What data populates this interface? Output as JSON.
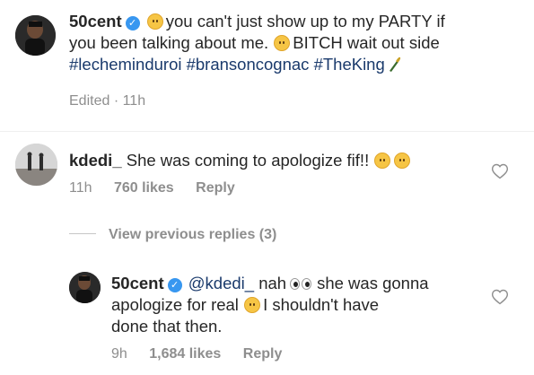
{
  "post": {
    "username": "50cent",
    "caption_part1": "you can't just show up to my PARTY if",
    "caption_part2": "you been talking about me.",
    "caption_part3": "BITCH wait out side",
    "hashtags": [
      "#lecheminduroi",
      "#bransoncognac",
      "#TheKing"
    ],
    "edited": "Edited",
    "time": "11h"
  },
  "comment": {
    "username": "kdedi_",
    "text": "She was coming to apologize fif!!",
    "time": "11h",
    "likes": "760 likes",
    "reply_label": "Reply"
  },
  "view_previous": "View previous replies (3)",
  "reply": {
    "username": "50cent",
    "mention": "@kdedi_",
    "text_part1": "nah",
    "text_part2": "she was gonna",
    "text_line2": "apologize for real",
    "text_part3": "I shouldn't have",
    "text_line3": "done that then.",
    "time": "9h",
    "likes": "1,684 likes",
    "reply_label": "Reply"
  },
  "colors": {
    "link": "#1a3a6c",
    "verified": "#3897f0",
    "muted": "#8e8e8e"
  },
  "icons": [
    "verified-badge-icon",
    "thinking-emoji-icon",
    "smirk-emoji-icon",
    "champagne-icon",
    "tears-of-joy-emoji-icon",
    "eyes-emoji-icon",
    "worried-emoji-icon",
    "heart-icon"
  ]
}
